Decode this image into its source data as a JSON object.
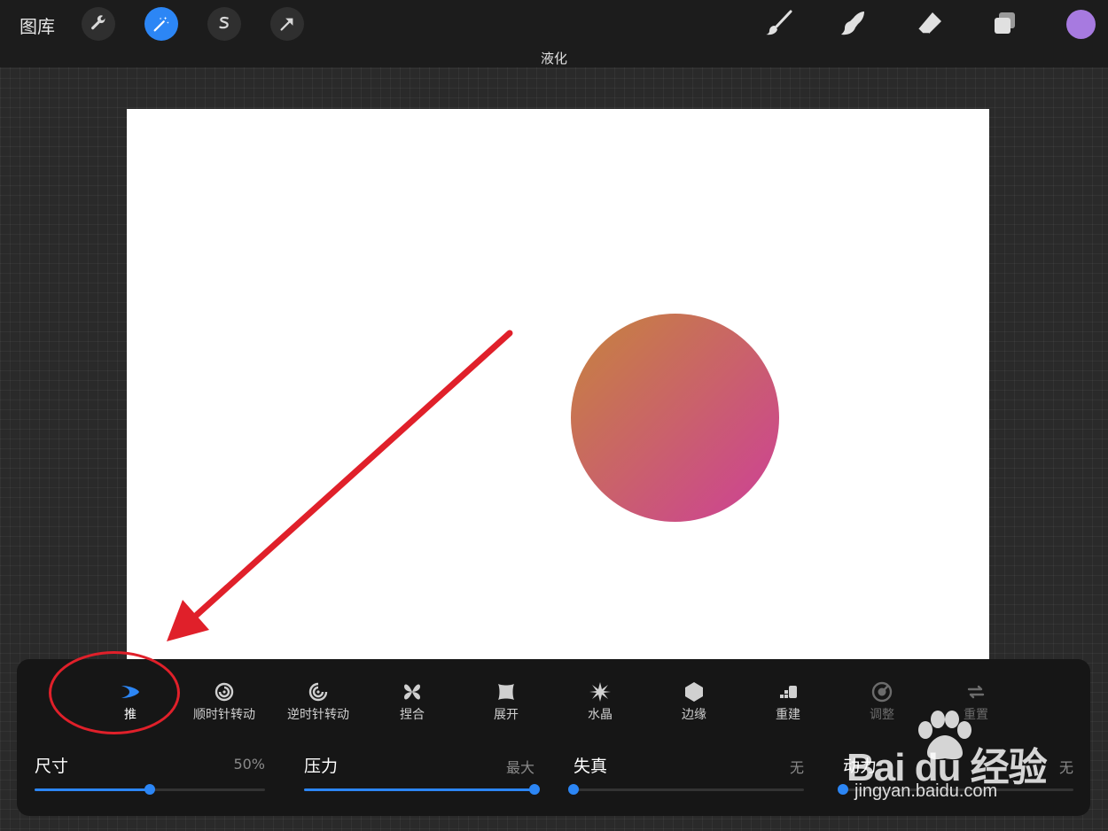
{
  "topbar": {
    "gallery_label": "图库",
    "mode_title": "液化",
    "left_buttons": [
      "wrench-icon",
      "magic-wand-icon",
      "selection-icon",
      "transform-arrow-icon"
    ],
    "right_tools": [
      "brush-icon",
      "smudge-icon",
      "eraser-icon",
      "layers-icon"
    ],
    "current_color": "#a77ae0"
  },
  "canvas": {
    "background": "#ffffff",
    "circle_gradient": [
      "#c77a4a",
      "#cc4a8a"
    ]
  },
  "liquify_panel": {
    "modes": [
      {
        "icon": "push-icon",
        "label": "推",
        "state": "active"
      },
      {
        "icon": "twirl-right-icon",
        "label": "顺时针转动",
        "state": "normal"
      },
      {
        "icon": "twirl-left-icon",
        "label": "逆时针转动",
        "state": "normal"
      },
      {
        "icon": "pinch-icon",
        "label": "捏合",
        "state": "normal"
      },
      {
        "icon": "expand-icon",
        "label": "展开",
        "state": "normal"
      },
      {
        "icon": "crystals-icon",
        "label": "水晶",
        "state": "normal"
      },
      {
        "icon": "edge-icon",
        "label": "边缘",
        "state": "normal"
      },
      {
        "icon": "reconstruct-icon",
        "label": "重建",
        "state": "normal"
      },
      {
        "icon": "adjust-icon",
        "label": "调整",
        "state": "disabled"
      },
      {
        "icon": "reset-icon",
        "label": "重置",
        "state": "disabled"
      }
    ],
    "sliders": [
      {
        "name": "尺寸",
        "value": "50%",
        "fraction": 0.5
      },
      {
        "name": "压力",
        "value": "最大",
        "fraction": 1.0
      },
      {
        "name": "失真",
        "value": "无",
        "fraction": 0.0
      },
      {
        "name": "动力",
        "value": "无",
        "fraction": 0.0
      }
    ]
  },
  "watermark": {
    "brand": "Bai du 经验",
    "url": "jingyan.baidu.com"
  },
  "colors": {
    "accent": "#2c86f5",
    "annotation": "#e0202a"
  }
}
